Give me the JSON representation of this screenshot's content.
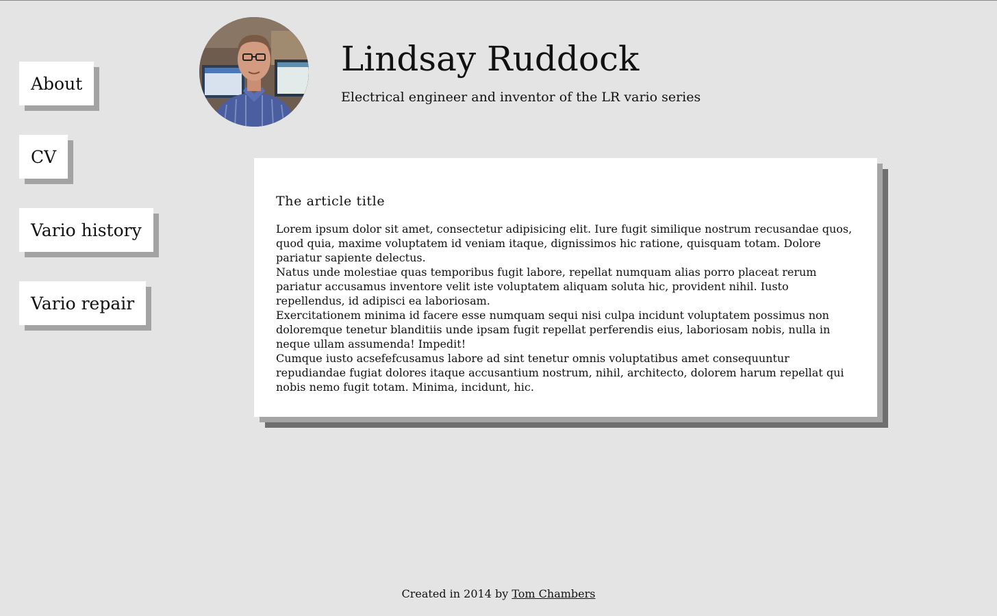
{
  "nav": {
    "items": [
      {
        "label": "About"
      },
      {
        "label": "CV"
      },
      {
        "label": "Vario history"
      },
      {
        "label": "Vario repair"
      }
    ]
  },
  "header": {
    "title": "Lindsay Ruddock",
    "subtitle": "Electrical engineer and inventor of the LR vario series"
  },
  "article": {
    "title": "The article title",
    "paragraphs": [
      "Lorem ipsum dolor sit amet, consectetur adipisicing elit. Iure fugit similique nostrum recusandae quos, quod quia, maxime voluptatem id veniam itaque, dignissimos hic ratione, quisquam totam. Dolore pariatur sapiente delectus.",
      "Natus unde molestiae quas temporibus fugit labore, repellat numquam alias porro placeat rerum pariatur accusamus inventore velit iste voluptatem aliquam soluta hic, provident nihil. Iusto repellendus, id adipisci ea laboriosam.",
      "Exercitationem minima id facere esse numquam sequi nisi culpa incidunt voluptatem possimus non doloremque tenetur blanditiis unde ipsam fugit repellat perferendis eius, laboriosam nobis, nulla in neque ullam assumenda! Impedit!",
      "Cumque iusto acsefefcusamus labore ad sint tenetur omnis voluptatibus amet consequuntur repudiandae fugiat dolores itaque accusantium nostrum, nihil, architecto, dolorem harum repellat qui nobis nemo fugit totam. Minima, incidunt, hic."
    ]
  },
  "footer": {
    "text": "Created in 2014 by ",
    "author_link": "Tom Chambers"
  },
  "colors": {
    "background": "#e4e4e4",
    "card": "#ffffff",
    "shadow_light": "#a5a5a5",
    "shadow_dark": "#6f6f6f"
  }
}
